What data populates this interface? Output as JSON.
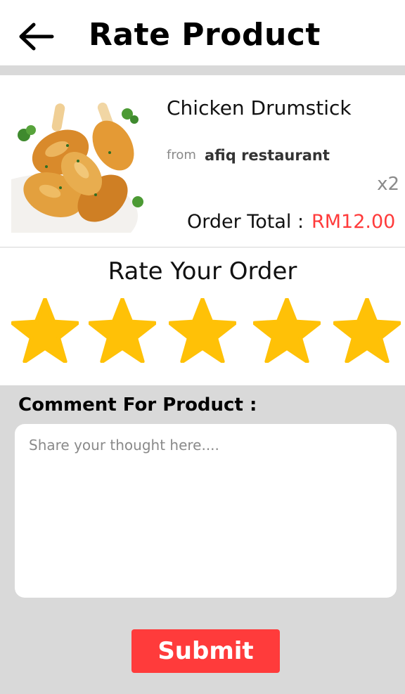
{
  "header": {
    "title": "Rate Product",
    "back_icon": "arrow-left-icon"
  },
  "product": {
    "name": "Chicken Drumstick",
    "from_label": "from",
    "restaurant": "afiq restaurant",
    "quantity": "x2",
    "order_total_label": "Order Total :",
    "order_total_value": "RM12.00",
    "image": "chicken-drumstick-photo"
  },
  "rating": {
    "title": "Rate Your Order",
    "stars": 5,
    "max": 5,
    "star_color": "#FFC107",
    "icon": "star-icon"
  },
  "comment": {
    "label": "Comment For Product :",
    "placeholder": "Share your thought here....",
    "value": ""
  },
  "submit": {
    "label": "Submit"
  },
  "colors": {
    "accent": "#FF3B3B",
    "background": "#D9D9D9",
    "star": "#FFC107"
  }
}
